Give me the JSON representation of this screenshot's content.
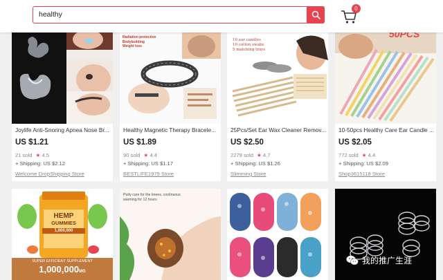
{
  "search": {
    "query": "healthy"
  },
  "cart": {
    "count": "0"
  },
  "products": [
    {
      "title": "Joylife Anti-Snoring Apnea Nose Br...",
      "price": "US $1.21",
      "sold": "21 sold",
      "rating": "4.5",
      "shipping": "+ Shipping: US $2.12",
      "store": "Welcome DropShipping Store"
    },
    {
      "title": "Healthy Magnetic Therapy Bracele...",
      "price": "US $1.89",
      "sold": "90 sold",
      "rating": "4.4",
      "shipping": "+ Shipping: US $1.17",
      "store": "BESTLIFE1979 Store",
      "image_text": [
        "Radiation protection",
        "Bodybuilding",
        "Weight loss"
      ]
    },
    {
      "title": "25Pcs/Set Ear Wax Cleaner Remov...",
      "price": "US $2.50",
      "sold": "2279 sold",
      "rating": "4.7",
      "shipping": "+ Shipping: US $1.26",
      "store": "Slimming Store",
      "image_text": [
        "10 ear candles",
        "10 cotton swabs",
        "5 matching trays"
      ]
    },
    {
      "title": "10-50pcs Healthy Care Ear Candle ...",
      "price": "US $2.05",
      "sold": "772 sold",
      "rating": "4.4",
      "shipping": "+ Shipping: US $2.09",
      "store": "Shop3615118 Store",
      "image_text": "50PCS"
    },
    {
      "image_text": {
        "brand": "HEMP",
        "name": "GUMMIES",
        "sub": "1,000,000",
        "banner": "SUPER EFFICIENT SUPPLEMENT",
        "big": "1,000,000",
        "unit": "MG"
      }
    },
    {
      "image_text": [
        "Putty care for the knees, continuous",
        "warming for 12 hours"
      ]
    },
    {},
    {}
  ],
  "watermark": "我的推广生涯",
  "colors": {
    "accent": "#e8434f",
    "star": "#e8434f",
    "background": "#f0f0f0"
  },
  "icons": {
    "search": "search-icon",
    "cart": "cart-icon",
    "star": "star-icon",
    "wechat": "wechat-icon"
  }
}
